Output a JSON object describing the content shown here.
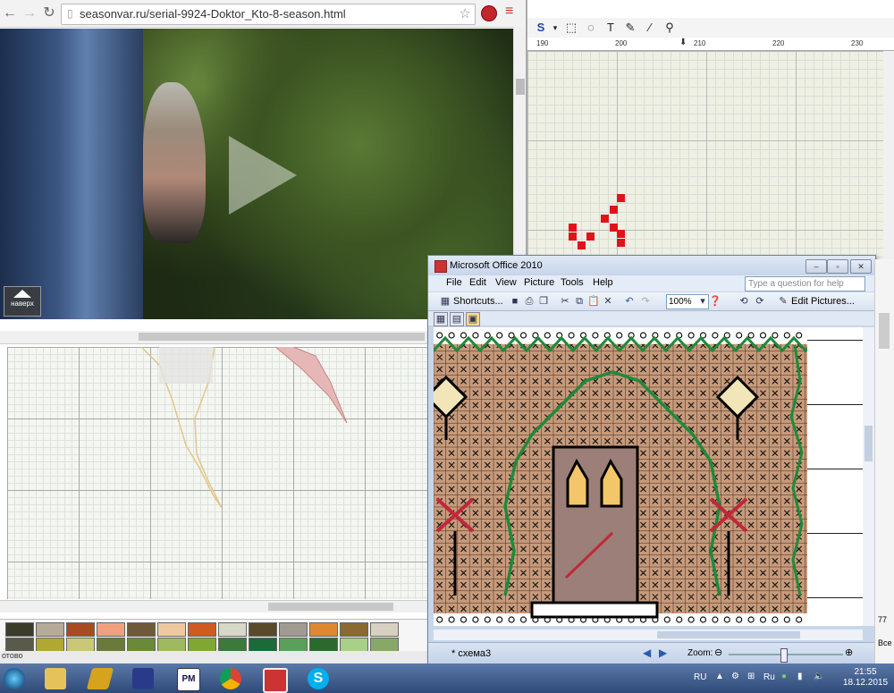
{
  "browser": {
    "url": "seasonvar.ru/serial-9924-Doktor_Kto-8-season.html",
    "up_button_label": "наверх"
  },
  "pattern_app": {
    "ruler_labels": [
      "190",
      "200",
      "210",
      "220",
      "230"
    ],
    "tool_label_text": "T",
    "status_text": "отово"
  },
  "palette": {
    "row1": [
      "#3b3d2c",
      "#b8aa98",
      "#a84a22",
      "#f0a080",
      "#6e5a38",
      "#f0c8a0",
      "#d05a20",
      "#d8d8c8",
      "#5a4a2a",
      "#a09a90",
      "#e08830",
      "#8a6a30",
      "#d8d0c0"
    ],
    "row2": [
      "#5a5a4a",
      "#b0a830",
      "#c8c878",
      "#6a7a3a",
      "#6a8a3a",
      "#a0b860",
      "#80a830",
      "#3a7a3a",
      "#1a6a3a",
      "#5aa05a",
      "#2a6a2a",
      "#a8d088",
      "#88a868"
    ]
  },
  "office": {
    "title": "Microsoft Office 2010",
    "menu": [
      "File",
      "Edit",
      "View",
      "Picture",
      "Tools",
      "Help"
    ],
    "help_placeholder": "Type a question for help",
    "shortcuts_label": "Shortcuts...",
    "zoom_value": "100%",
    "edit_pictures_label": "Edit Pictures...",
    "status_file": "* схема3",
    "zoom_label": "Zoom:"
  },
  "edge_strip": {
    "num": "77",
    "text": "Все"
  },
  "taskbar": {
    "apps": [
      "start",
      "explorer",
      "winamp",
      "save",
      "pattern-maker",
      "chrome",
      "picture-manager",
      "skype"
    ],
    "lang": "RU",
    "lang2": "Ru",
    "time": "21:55",
    "date": "18.12.2015"
  }
}
